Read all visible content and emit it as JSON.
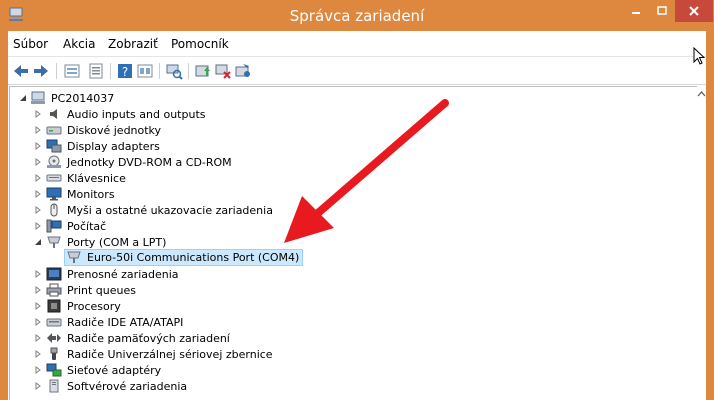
{
  "window": {
    "title": "Správca zariadení"
  },
  "menu": [
    "Súbor",
    "Akcia",
    "Zobraziť",
    "Pomocník"
  ],
  "toolbar": [
    "back-icon",
    "forward-icon",
    "tree-view-icon",
    "properties-icon",
    "help-icon",
    "view-icon",
    "scan-hardware-icon",
    "update-driver-icon",
    "disable-device-icon",
    "uninstall-device-icon"
  ],
  "tree": {
    "root": "PC2014037",
    "items": [
      {
        "label": "Audio inputs and outputs",
        "icon": "speaker-icon",
        "expanded": false
      },
      {
        "label": "Diskové jednotky",
        "icon": "disk-drive-icon",
        "expanded": false
      },
      {
        "label": "Display adapters",
        "icon": "display-adapter-icon",
        "expanded": false
      },
      {
        "label": "Jednotky DVD-ROM a CD-ROM",
        "icon": "dvd-drive-icon",
        "expanded": false
      },
      {
        "label": "Klávesnice",
        "icon": "keyboard-icon",
        "expanded": false
      },
      {
        "label": "Monitors",
        "icon": "monitor-icon",
        "expanded": false
      },
      {
        "label": "Myši a ostatné ukazovacie zariadenia",
        "icon": "mouse-icon",
        "expanded": false
      },
      {
        "label": "Počítač",
        "icon": "computer-icon",
        "expanded": false
      },
      {
        "label": "Porty (COM a LPT)",
        "icon": "port-icon",
        "expanded": true
      },
      {
        "label": "Euro-50i Communications Port (COM4)",
        "icon": "port-icon",
        "child": true,
        "selected": true
      },
      {
        "label": "Prenosné zariadenia",
        "icon": "portable-device-icon",
        "expanded": false
      },
      {
        "label": "Print queues",
        "icon": "printer-icon",
        "expanded": false
      },
      {
        "label": "Procesory",
        "icon": "processor-icon",
        "expanded": false
      },
      {
        "label": "Radiče IDE ATA/ATAPI",
        "icon": "ide-controller-icon",
        "expanded": false
      },
      {
        "label": "Radiče pamäťových zariadení",
        "icon": "storage-controller-icon",
        "expanded": false
      },
      {
        "label": "Radiče Univerzálnej sériovej zbernice",
        "icon": "usb-icon",
        "expanded": false
      },
      {
        "label": "Sieťové adaptéry",
        "icon": "network-adapter-icon",
        "expanded": false
      },
      {
        "label": "Softvérové zariadenia",
        "icon": "software-device-icon",
        "expanded": false
      }
    ]
  },
  "colors": {
    "titlebar": "#dd873f",
    "close": "#c7493b",
    "arrow": "#e8191f",
    "selection": "#cce8ff"
  }
}
